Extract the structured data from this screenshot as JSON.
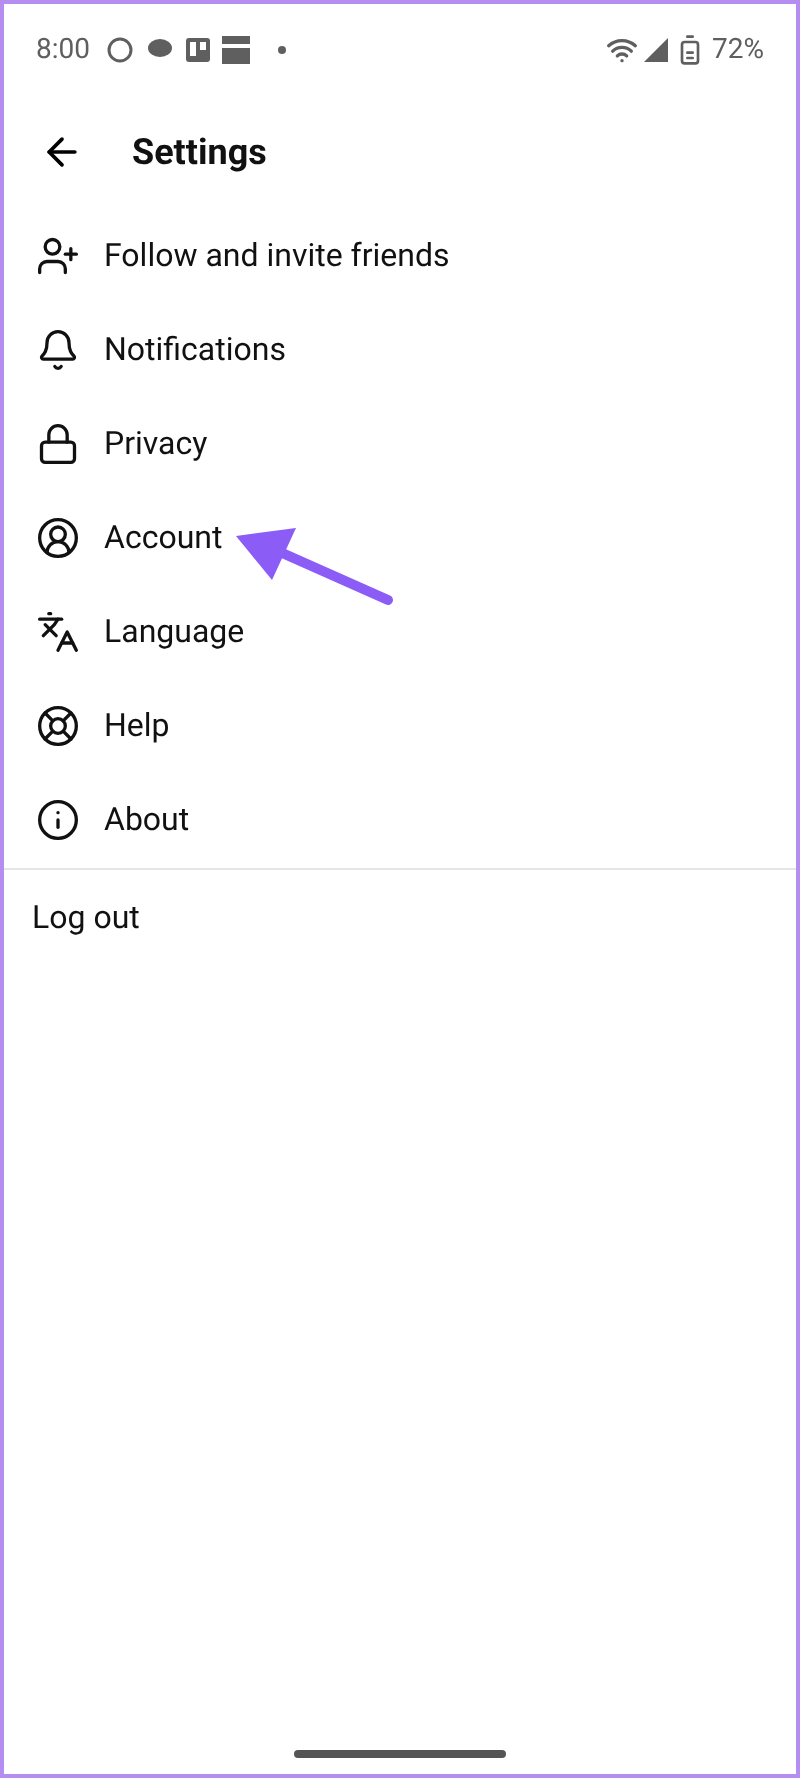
{
  "status_bar": {
    "time": "8:00",
    "battery": "72%"
  },
  "header": {
    "title": "Settings"
  },
  "menu_items": [
    {
      "label": "Follow and invite friends"
    },
    {
      "label": "Notifications"
    },
    {
      "label": "Privacy"
    },
    {
      "label": "Account"
    },
    {
      "label": "Language"
    },
    {
      "label": "Help"
    },
    {
      "label": "About"
    }
  ],
  "logout": {
    "label": "Log out"
  }
}
